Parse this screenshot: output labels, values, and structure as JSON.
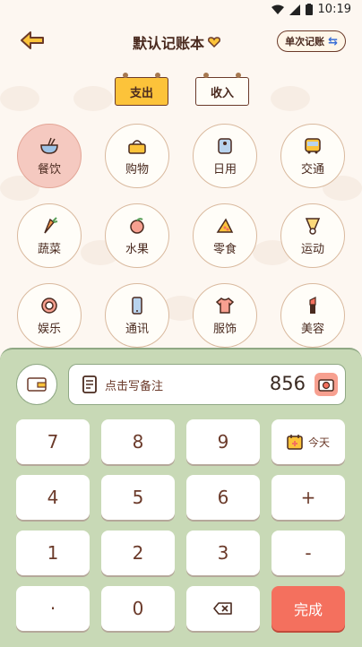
{
  "status": {
    "time": "10:19"
  },
  "header": {
    "title": "默认记账本",
    "mode_button": "单次记账"
  },
  "tabs": {
    "expense": "支出",
    "income": "收入"
  },
  "categories": [
    {
      "label": "餐饮",
      "icon": "bowl-icon",
      "selected": true
    },
    {
      "label": "购物",
      "icon": "basket-icon"
    },
    {
      "label": "日用",
      "icon": "toilet-paper-icon"
    },
    {
      "label": "交通",
      "icon": "bus-icon"
    },
    {
      "label": "蔬菜",
      "icon": "carrot-icon"
    },
    {
      "label": "水果",
      "icon": "peach-icon"
    },
    {
      "label": "零食",
      "icon": "pizza-icon"
    },
    {
      "label": "运动",
      "icon": "shuttlecock-icon"
    },
    {
      "label": "娱乐",
      "icon": "dartboard-icon"
    },
    {
      "label": "通讯",
      "icon": "phone-icon"
    },
    {
      "label": "服饰",
      "icon": "shirt-icon"
    },
    {
      "label": "美容",
      "icon": "lipstick-icon"
    }
  ],
  "entry": {
    "note_placeholder": "点击写备注",
    "amount": "856"
  },
  "keys": {
    "k7": "7",
    "k8": "8",
    "k9": "9",
    "today": "今天",
    "k4": "4",
    "k5": "5",
    "k6": "6",
    "plus": "+",
    "k1": "1",
    "k2": "2",
    "k3": "3",
    "minus": "-",
    "dot": "·",
    "k0": "0",
    "done": "完成"
  }
}
